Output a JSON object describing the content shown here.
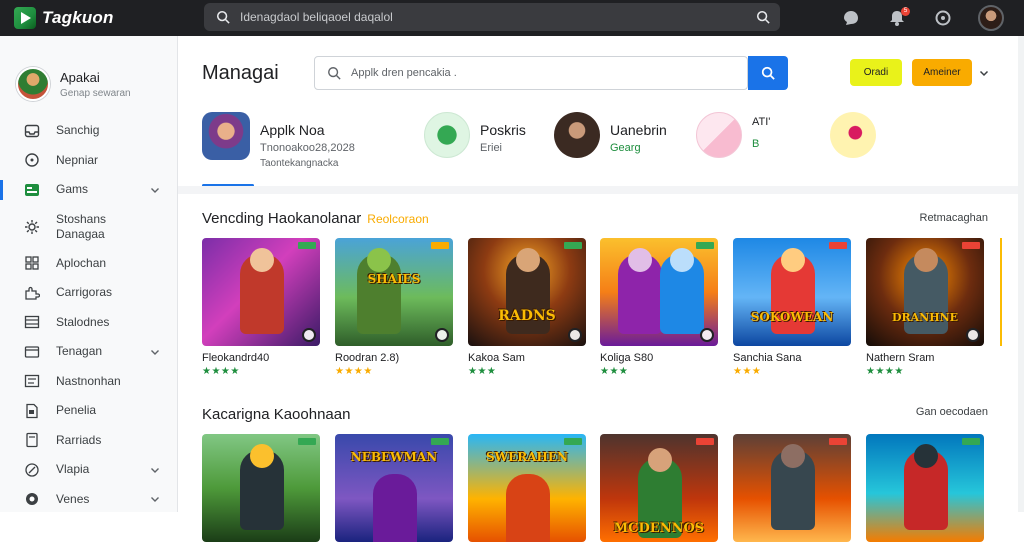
{
  "topbar": {
    "logo_text": "Tagkuon",
    "search_placeholder": "Idenagdaol beliqaoel daqalol",
    "notif_count": "5"
  },
  "sidebar": {
    "profile_name": "Apakai",
    "profile_sub": "Genap sewaran",
    "items": [
      {
        "label": "Sanchig",
        "icon": "inbox-icon"
      },
      {
        "label": "Nepniar",
        "icon": "clock-icon"
      },
      {
        "label": "Gams",
        "icon": "games-icon"
      },
      {
        "label": "Stoshans Danagaa",
        "icon": "settings-icon"
      },
      {
        "label": "Aplochan",
        "icon": "apps-icon"
      },
      {
        "label": "Carrigoras",
        "icon": "puzzle-icon"
      },
      {
        "label": "Stalodnes",
        "icon": "grid-icon"
      },
      {
        "label": "Tenagan",
        "icon": "card-icon"
      },
      {
        "label": "Nastnonhan",
        "icon": "list-icon"
      },
      {
        "label": "Penelia",
        "icon": "document-icon"
      },
      {
        "label": "Rarriads",
        "icon": "page-icon"
      },
      {
        "label": "Vlapia",
        "icon": "leaf-icon"
      },
      {
        "label": "Venes",
        "icon": "circle-icon"
      }
    ]
  },
  "main": {
    "title": "Managai",
    "search_placeholder": "Applk dren pencakia .",
    "btn_yellow": "Oradi",
    "btn_orange": "Ameiner"
  },
  "featured": [
    {
      "name": "Applk Noa",
      "sub": "Tnonoakoo28,2028",
      "sub2": "Taontekangnacka"
    },
    {
      "name": "Poskris",
      "sub": "Eriei"
    },
    {
      "name": "Uanebrin",
      "sub": "Gearg"
    },
    {
      "name": "ATI'",
      "sub": "B"
    }
  ],
  "section1": {
    "title": "Vencding Haokanolanar",
    "accent": "Reolcoraon",
    "see_more": "Retmacaghan",
    "cards": [
      {
        "title": "Fleokandrd40",
        "stars": "★★★★",
        "star_color": "green"
      },
      {
        "title": "Roodran 2.8)",
        "stars": "★★★★",
        "star_color": "yellow",
        "art_text": "SHAIES"
      },
      {
        "title": "Kakoa Sam",
        "stars": "★★★",
        "star_color": "green",
        "art_text": "RADNS"
      },
      {
        "title": "Koliga S80",
        "stars": "★★★",
        "star_color": "green",
        "art_text": ""
      },
      {
        "title": "Sanchia Sana",
        "stars": "★★★",
        "star_color": "yellow",
        "art_text": "SOKOWEAN"
      },
      {
        "title": "Nathern Sram",
        "stars": "★★★★",
        "star_color": "green",
        "art_text": "DRANHNE"
      }
    ]
  },
  "section2": {
    "title": "Kacarigna Kaoohnaan",
    "see_more": "Gan oecodaen",
    "cards": [
      {
        "art_text": ""
      },
      {
        "art_text": "NEBEWMAN"
      },
      {
        "art_text": "SWERAHEN"
      },
      {
        "art_text": "MCDENNOS"
      },
      {
        "art_text": ""
      },
      {
        "art_text": ""
      }
    ]
  },
  "colors": {
    "accent": "#1a73e8",
    "yellow_btn": "#e9f21a",
    "orange_btn": "#f9ab00",
    "topbar_bg": "#1f2023"
  }
}
